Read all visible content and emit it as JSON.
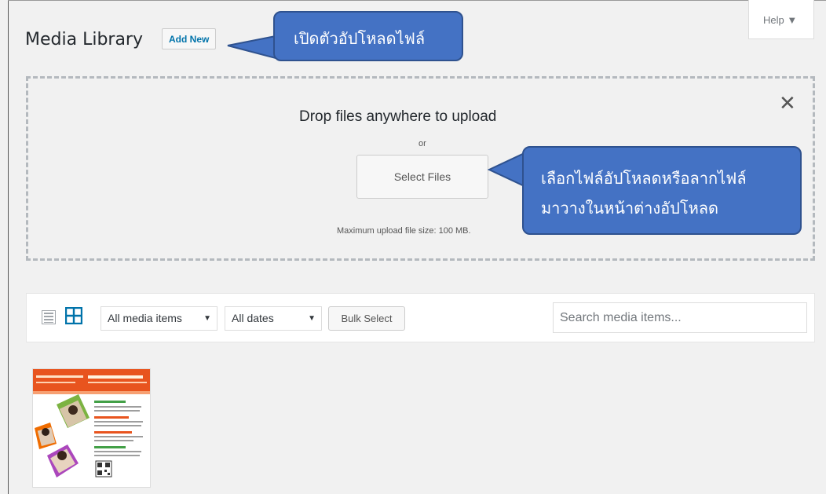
{
  "header": {
    "title": "Media Library",
    "add_new_label": "Add New",
    "help_label": "Help ▼"
  },
  "annotations": {
    "callout_add_new": "เปิดตัวอัปโหลดไฟล์",
    "callout_select_line1": "เลือกไฟล์อัปโหลดหรือลากไฟล์",
    "callout_select_line2": "มาวางในหน้าต่างอัปโหลด",
    "callout_color": "#4472c4"
  },
  "uploader": {
    "drop_text": "Drop files anywhere to upload",
    "or_text": "or",
    "select_files_label": "Select Files",
    "max_size_text": "Maximum upload file size: 100 MB.",
    "close_icon": "close-icon"
  },
  "toolbar": {
    "list_view_icon": "list-view-icon",
    "grid_view_icon": "grid-view-icon",
    "media_filter": "All media items",
    "date_filter": "All dates",
    "bulk_select_label": "Bulk Select",
    "search_placeholder": "Search media items..."
  },
  "media": {
    "items": [
      {
        "type": "image",
        "title": "thumbnail"
      }
    ],
    "accent": "#0073aa"
  }
}
